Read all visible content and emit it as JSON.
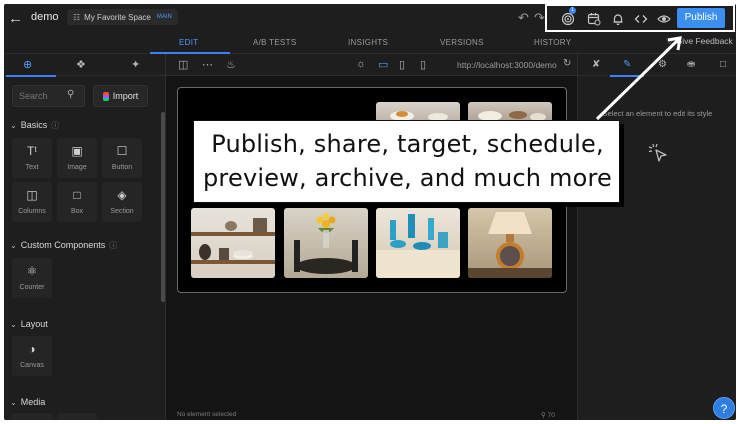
{
  "header": {
    "project_name": "demo",
    "space_name": "My Favorite Space",
    "space_badge": "MAIN",
    "publish_label": "Publish",
    "notification_count": "1"
  },
  "tabs": [
    "EDIT",
    "A/B TESTS",
    "INSIGHTS",
    "VERSIONS",
    "HISTORY"
  ],
  "active_tab": "EDIT",
  "feedback_label": "Give Feedback",
  "left_panel": {
    "search_placeholder": "Search",
    "import_label": "Import",
    "sections": {
      "basics": "Basics",
      "custom": "Custom Components",
      "layout": "Layout",
      "media": "Media"
    },
    "basics_items": [
      "Text",
      "Image",
      "Button",
      "Columns",
      "Box",
      "Section"
    ],
    "custom_items": [
      "Counter"
    ],
    "layout_items": [
      "Canvas"
    ]
  },
  "canvas": {
    "url": "http://localhost:3000/demo",
    "status": "No element selected",
    "zoom": "70"
  },
  "right_panel": {
    "hint": "Select an element to edit its style"
  },
  "callout": {
    "line1": "Publish, share, target, schedule,",
    "line2": "preview, archive, and much more"
  },
  "colors": {
    "accent": "#3b8ff0",
    "background": "#1e1e1e",
    "canvas": "#141414"
  }
}
